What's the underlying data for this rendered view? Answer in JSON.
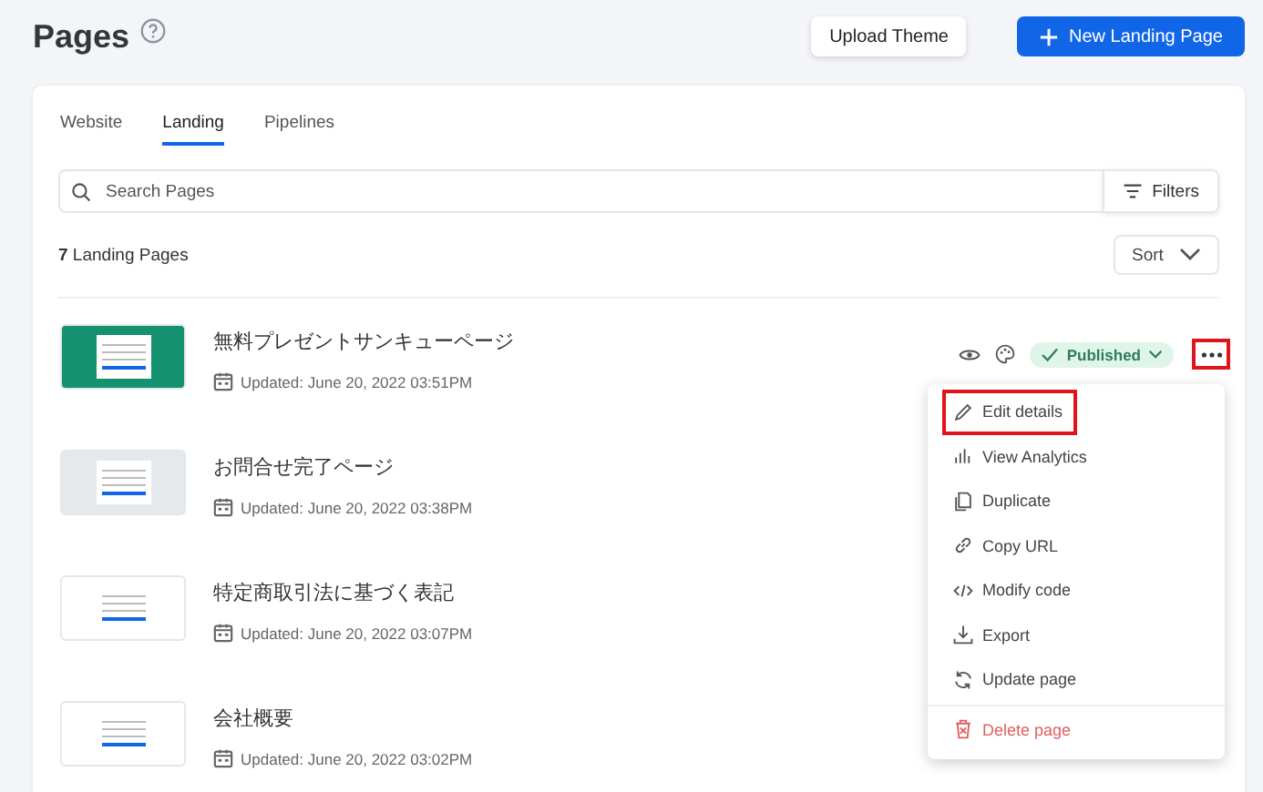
{
  "header": {
    "title": "Pages",
    "buttons": [
      {
        "label": "Upload Theme",
        "kind": "secondary"
      },
      {
        "label": "New Landing Page",
        "kind": "primary"
      }
    ]
  },
  "tabs": [
    {
      "label": "Website",
      "selected": false
    },
    {
      "label": "Landing",
      "selected": true
    },
    {
      "label": "Pipelines",
      "selected": false
    }
  ],
  "search": {
    "placeholder": "Search Pages",
    "filters": "Filters"
  },
  "summary": {
    "count": "7",
    "label": "Landing Pages",
    "sort": "Sort"
  },
  "pages": [
    {
      "title": "無料プレゼントサンキューページ",
      "updated": "Updated: June 20, 2022 03:51PM",
      "color": "#14916f",
      "hovered": true,
      "status": "Published"
    },
    {
      "title": "お問合せ完了ページ",
      "updated": "Updated: June 20, 2022 03:38PM",
      "color": "#e6e9ec",
      "hovered": false
    },
    {
      "title": "特定商取引法に基づく表記",
      "updated": "Updated: June 20, 2022 03:07PM",
      "color": "#ffffff",
      "hovered": false
    },
    {
      "title": "会社概要",
      "updated": "Updated: June 20, 2022 03:02PM",
      "color": "#ffffff",
      "hovered": false
    }
  ],
  "more_button": {
    "highlighted": true
  },
  "menu": [
    {
      "label": "Edit details",
      "kind": "normal",
      "highlighted": true
    },
    {
      "label": "View Analytics",
      "kind": "normal",
      "highlighted": false
    },
    {
      "label": "Duplicate",
      "kind": "normal",
      "highlighted": false
    },
    {
      "label": "Copy URL",
      "kind": "normal",
      "highlighted": false
    },
    {
      "label": "Modify code",
      "kind": "normal",
      "highlighted": false
    },
    {
      "label": "Export",
      "kind": "normal",
      "highlighted": false
    },
    {
      "label": "Update page",
      "kind": "normal",
      "highlighted": false
    },
    {
      "label": "Delete page",
      "kind": "danger",
      "highlighted": false
    }
  ]
}
